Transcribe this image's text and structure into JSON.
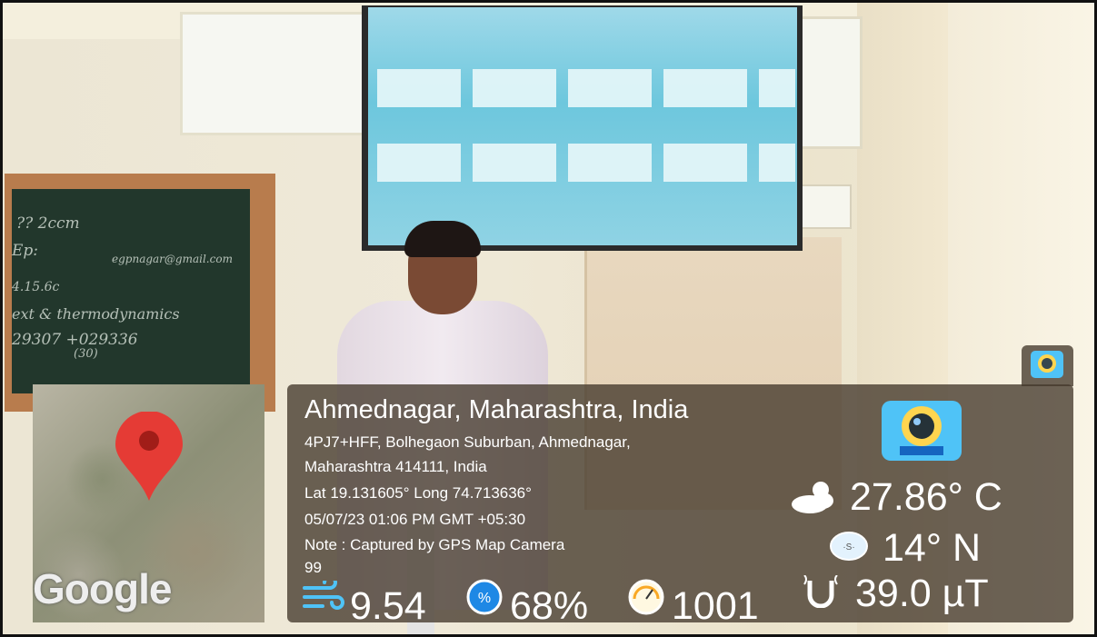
{
  "stamp": {
    "location_title": "Ahmednagar, Maharashtra, India",
    "address_line1": "4PJ7+HFF, Bolhegaon Suburban, Ahmednagar,",
    "address_line2": "Maharashtra 414111, India",
    "coordinates": "Lat 19.131605° Long 74.713636°",
    "datetime": "05/07/23 01:06 PM GMT +05:30",
    "note": "Note : Captured by GPS Map Camera",
    "extra_line": "99",
    "map_logo": "Google",
    "temperature": "27.86° C",
    "compass": "14° N",
    "magnetic": "39.0 µT",
    "wind": "9.54",
    "humidity": "68%",
    "pressure": "1001"
  },
  "chalkboard": {
    "lines": [
      "?? 2ccm",
      "Ep:",
      "egpnagar@gmail.com",
      "4.15.6c",
      "ext & thermodynamics",
      "29307 +029336",
      "(30)"
    ]
  },
  "icons": {
    "weather": "cloud-sun-icon",
    "compass": "compass-icon",
    "magnet": "magnet-icon",
    "wind": "wind-icon",
    "humidity": "humidity-icon",
    "pressure": "gauge-icon",
    "app": "gps-camera-app-icon",
    "pin": "map-pin-icon"
  },
  "colors": {
    "pin": "#e53b35",
    "overlay": "#44382c",
    "wind": "#4fc3f7"
  }
}
